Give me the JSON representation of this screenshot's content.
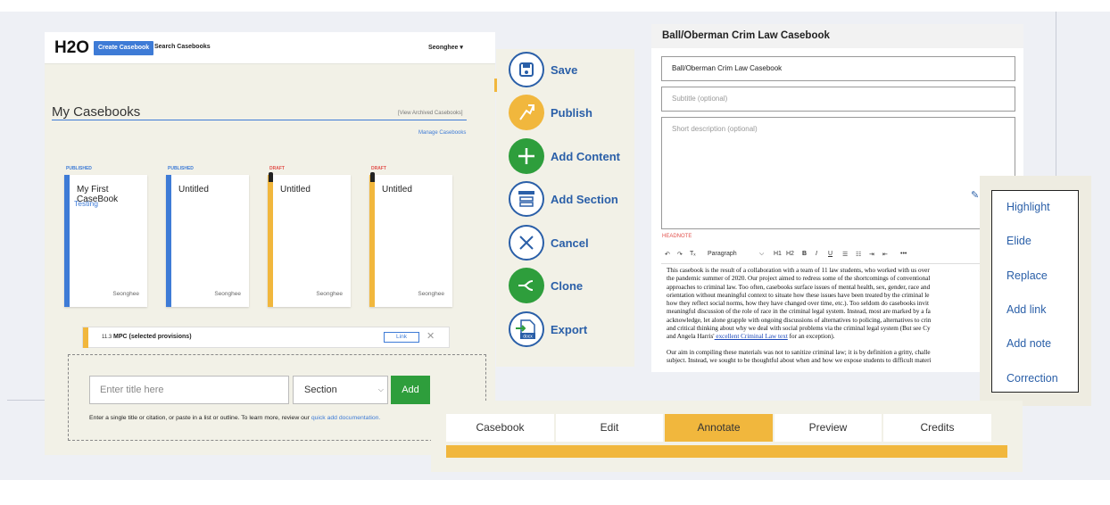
{
  "colors": {
    "brand_blue": "#3e7bd6",
    "action_blue": "#2a5fa8",
    "green": "#2e9e3c",
    "orange": "#f1b73d",
    "draft_red": "#e2504b",
    "panel_beige": "#f2f1e7"
  },
  "header": {
    "logo": "H2O",
    "create_btn": "Create Casebook",
    "search_link": "Search Casebooks",
    "user_menu": "Seonghee ▾"
  },
  "casebooks": {
    "title": "My Casebooks",
    "archived_link": "[View Archived Casebooks]",
    "manage_link": "Manage Casebooks",
    "cards": [
      {
        "status": "PUBLISHED",
        "title": "My First CaseBook",
        "subtitle": "Testing",
        "author": "Seonghee"
      },
      {
        "status": "PUBLISHED",
        "title": "Untitled",
        "subtitle": "",
        "author": "Seonghee"
      },
      {
        "status": "DRAFT",
        "title": "Untitled",
        "subtitle": "",
        "author": "Seonghee"
      },
      {
        "status": "DRAFT",
        "title": "Untitled",
        "subtitle": "",
        "author": "Seonghee"
      }
    ]
  },
  "resource_row": {
    "number": "11.3",
    "title": "MPC (selected provisions)",
    "link_label": "Link",
    "remove": "✕"
  },
  "quick_add": {
    "placeholder": "Enter title here",
    "type_select": "Section",
    "add_label": "Add",
    "help_text": "Enter a single title or citation, or paste in a list or outline. To learn more, review our ",
    "help_link": "quick add documentation."
  },
  "actions": [
    {
      "label": "Save",
      "icon": "save-icon"
    },
    {
      "label": "Publish",
      "icon": "publish-icon"
    },
    {
      "label": "Add Content",
      "icon": "add-content-icon"
    },
    {
      "label": "Add Section",
      "icon": "add-section-icon"
    },
    {
      "label": "Cancel",
      "icon": "cancel-icon"
    },
    {
      "label": "Clone",
      "icon": "clone-icon"
    },
    {
      "label": "Export",
      "icon": "export-docx-icon",
      "icon_text": "docx"
    }
  ],
  "editor": {
    "heading": "Ball/Oberman Crim Law Casebook",
    "title_value": "Ball/Oberman Crim Law Casebook",
    "subtitle_placeholder": "Subtitle (optional)",
    "description_placeholder": "Short description (optional)",
    "headnote_label": "HEADNOTE",
    "toolbar": {
      "undo": "↶",
      "redo": "↷",
      "clear": "Tₓ",
      "paragraph": "Paragraph",
      "chevron": "⌵",
      "h1": "H1",
      "h2": "H2",
      "bold": "B",
      "italic": "I",
      "underline": "U",
      "ul": "☰",
      "ol": "☷",
      "indent": "⇥",
      "outdent": "⇤",
      "more": "•••"
    },
    "para1_lines": [
      "This casebook is the result of a collaboration with a team of 11 law students, who worked with us over",
      "the pandemic summer of 2020. Our project aimed to redress some of the shortcomings of conventional",
      "approaches to criminal law. Too often, casebooks surface issues of mental health, sex, gender, race and",
      "orientation without meaningful context to situate how these issues have been treated by the criminal le",
      "how they reflect social norms, how they have changed over time, etc.). Too seldom do casebooks invit",
      "meaningful discussion of the role of race in the criminal legal system. Instead, most are marked by a fa",
      "acknowledge, let alone grapple with ongoing discussions of alternatives to policing, alternatives to crin",
      "and critical thinking about why we deal with social problems via the criminal legal system (But see Cy"
    ],
    "para1_last": "and Angela Harris'",
    "para1_link": " excellent Criminal Law text",
    "para1_tail": " for an exception).",
    "para2_lines": [
      "Our aim in compiling these materials was not to sanitize criminal law; it is by definition a gritty, challe",
      "subject. Instead, we sought to be thoughtful about when and how we expose students to difficult materi"
    ]
  },
  "annotation_menu": [
    "Highlight",
    "Elide",
    "Replace",
    "Add link",
    "Add note",
    "Correction"
  ],
  "tabs": [
    {
      "label": "Casebook",
      "active": false
    },
    {
      "label": "Edit",
      "active": false
    },
    {
      "label": "Annotate",
      "active": true
    },
    {
      "label": "Preview",
      "active": false
    },
    {
      "label": "Credits",
      "active": false
    }
  ]
}
